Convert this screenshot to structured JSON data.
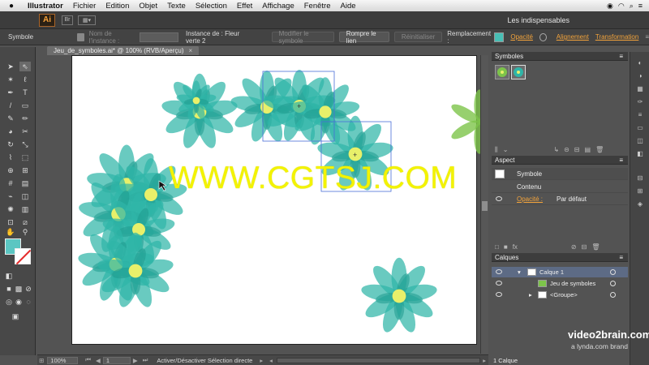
{
  "menubar": {
    "apple": "",
    "app": "Illustrator",
    "items": [
      "Fichier",
      "Edition",
      "Objet",
      "Texte",
      "Sélection",
      "Effet",
      "Affichage",
      "Fenêtre",
      "Aide"
    ]
  },
  "appbar": {
    "logo": "Ai",
    "bridge": "Br",
    "workspace": "Les indispensables"
  },
  "controlbar": {
    "mode": "Symbole",
    "instance_name_label": "Nom de l'instance :",
    "instance_name_value": "",
    "instance_of": "Instance de : Fleur verte 2",
    "edit_symbol": "Modifier le symbole",
    "break_link": "Rompre le lien",
    "reset": "Réinitialiser",
    "replace_label": "Remplacement :",
    "opacity": "Opacité",
    "align": "Alignement",
    "transform": "Transformation"
  },
  "document": {
    "tab_title": "Jeu_de_symboles.ai* @ 100% (RVB/Aperçu)",
    "close": "×"
  },
  "statusbar": {
    "zoom": "100%",
    "page": "1",
    "status_text": "Activer/Désactiver Sélection directe"
  },
  "watermark": "WWW.CGTSJ.COM",
  "panels": {
    "symbols": {
      "title": "Symboles"
    },
    "aspect": {
      "title": "Aspect",
      "rows": [
        {
          "name": "Symbole",
          "value": ""
        },
        {
          "name": "Contenu",
          "value": ""
        },
        {
          "name": "Opacité :",
          "value": "Par défaut"
        }
      ]
    },
    "layers": {
      "title": "Calques",
      "rows": [
        {
          "name": "Calque 1"
        },
        {
          "name": "Jeu de symboles"
        },
        {
          "name": "<Groupe>"
        }
      ],
      "count": "1 Calque"
    }
  },
  "branding": {
    "primary": "video2brain.com",
    "secondary": "a lynda.com brand"
  },
  "colors": {
    "petal": "#2fb5a8",
    "center": "#e8f06a",
    "accent": "#f2a33b",
    "selection": "#4a6fd8"
  }
}
